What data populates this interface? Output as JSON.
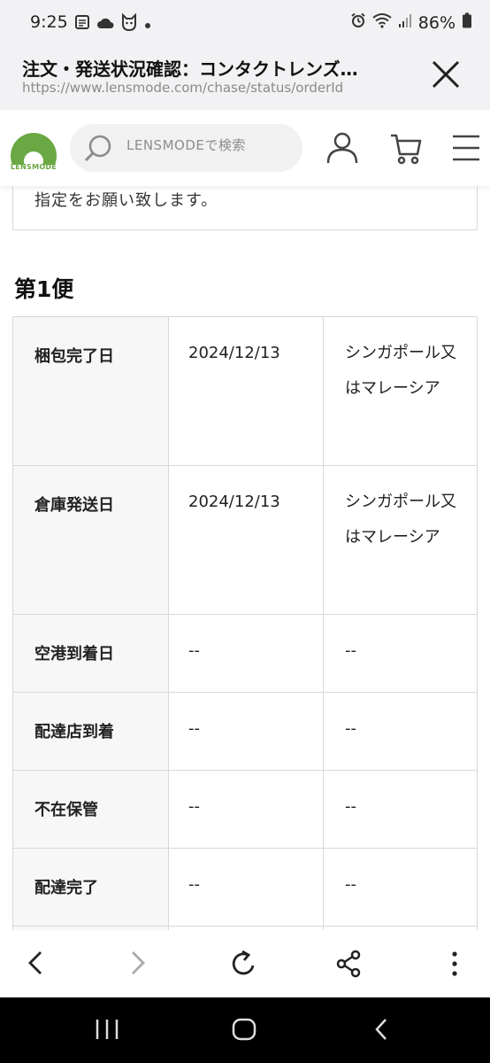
{
  "status_bar": {
    "time": "9:25",
    "battery": "86%",
    "left_icons": [
      "calendar-icon",
      "cloud-icon",
      "cat-icon",
      "dot-icon"
    ],
    "right_icons": [
      "alarm-icon",
      "wifi-icon",
      "signal-icon",
      "battery-icon"
    ]
  },
  "browser": {
    "page_title": "注文・発送状況確認：コンタクトレンズ…",
    "url": "https://www.lensmode.com/chase/status/orderId"
  },
  "site_header": {
    "logo_text": "LENSMODE",
    "search_placeholder": "LENSMODEで検索",
    "brand_color": "#6aa843"
  },
  "content": {
    "notice_text": "指定をお願い致します。",
    "section_title": "第1便",
    "rows": [
      {
        "label": "梱包完了日",
        "date": "2024/12/13",
        "area": "シンガポール又はマレーシア"
      },
      {
        "label": "倉庫発送日",
        "date": "2024/12/13",
        "area": "シンガポール又はマレーシア"
      },
      {
        "label": "空港到着日",
        "date": "--",
        "area": "--"
      },
      {
        "label": "配達店到着",
        "date": "--",
        "area": "--"
      },
      {
        "label": "不在保管",
        "date": "--",
        "area": "--"
      },
      {
        "label": "配達完了",
        "date": "--",
        "area": "--"
      }
    ]
  },
  "toolbar": {
    "icons": [
      "back-icon",
      "forward-icon",
      "reload-icon",
      "share-icon",
      "more-icon"
    ]
  },
  "system_nav": {
    "icons": [
      "recent-apps-icon",
      "home-icon",
      "system-back-icon"
    ]
  }
}
